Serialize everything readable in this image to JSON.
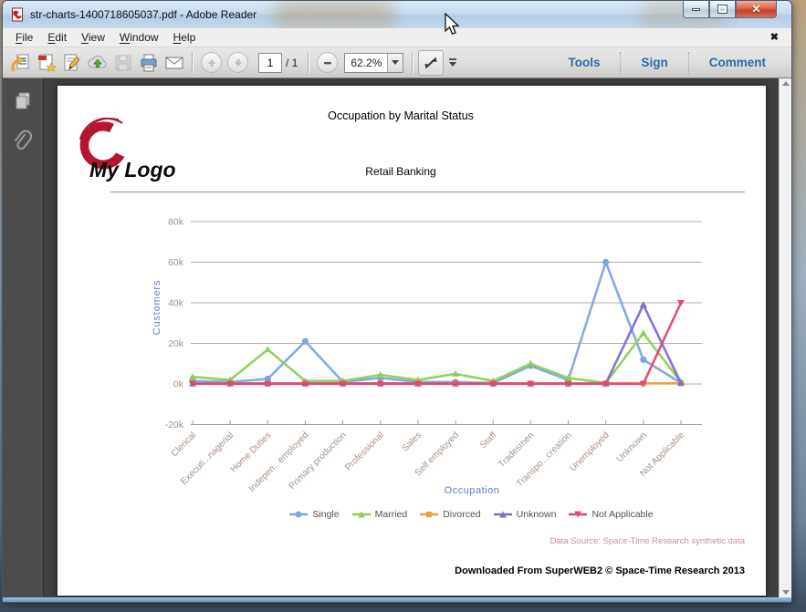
{
  "window": {
    "title": "str-charts-1400718605037.pdf - Adobe Reader"
  },
  "menu": {
    "items": [
      "File",
      "Edit",
      "View",
      "Window",
      "Help"
    ]
  },
  "toolbar": {
    "page_current": "1",
    "page_total": "/ 1",
    "zoom_value": "62.2%",
    "tools_label": "Tools",
    "sign_label": "Sign",
    "comment_label": "Comment"
  },
  "sidebar": {
    "items": [
      "page-thumbnails",
      "attachments"
    ]
  },
  "document": {
    "title": "Occupation by Marital Status",
    "subtitle": "Retail Banking",
    "logo_text": "My Logo",
    "data_source": "Data Source: Space-Time Research synthetic data",
    "footer": "Downloaded From SuperWEB2 © Space-Time Research 2013"
  },
  "chart_data": {
    "type": "line",
    "title": "Occupation by Marital Status",
    "xlabel": "Occupation",
    "ylabel": "Customers",
    "ylim": [
      -20000,
      80000
    ],
    "grid": true,
    "legend_position": "bottom",
    "yticks": [
      80000,
      60000,
      40000,
      20000,
      0,
      -20000
    ],
    "ytick_labels": [
      "80k",
      "60k",
      "40k",
      "20k",
      "0k",
      "-20k"
    ],
    "categories": [
      "Clerical",
      "Executi...nagerial",
      "Home Duties",
      "Indepen...employed",
      "Primary production",
      "Professional",
      "Sales",
      "Self employed",
      "Staff",
      "Tradesmen",
      "Transpo...creation",
      "Unemployed",
      "Unknown",
      "Not Applicable"
    ],
    "series": [
      {
        "name": "Single",
        "color": "#7ea4e4",
        "marker": "circle",
        "values": [
          1500,
          1000,
          2500,
          21000,
          1000,
          3000,
          1000,
          1000,
          500,
          9000,
          2000,
          60000,
          12000,
          500
        ]
      },
      {
        "name": "Married",
        "color": "#90cf55",
        "marker": "triangle",
        "values": [
          3500,
          2000,
          17000,
          1500,
          1500,
          4500,
          2000,
          5000,
          1500,
          10000,
          3000,
          500,
          25000,
          1000
        ]
      },
      {
        "name": "Divorced",
        "color": "#f09c3d",
        "marker": "square",
        "values": [
          300,
          300,
          300,
          300,
          300,
          300,
          300,
          300,
          300,
          300,
          300,
          300,
          300,
          300
        ]
      },
      {
        "name": "Unknown",
        "color": "#7d6bd8",
        "marker": "triangle",
        "values": [
          200,
          200,
          200,
          200,
          200,
          200,
          200,
          200,
          200,
          200,
          200,
          200,
          39000,
          500
        ]
      },
      {
        "name": "Not Applicable",
        "color": "#e6476d",
        "marker": "triangle-down",
        "values": [
          100,
          100,
          100,
          100,
          100,
          100,
          100,
          100,
          100,
          100,
          100,
          100,
          100,
          40000
        ]
      }
    ],
    "annotations": [
      "Data Source: Space-Time Research synthetic data"
    ]
  }
}
